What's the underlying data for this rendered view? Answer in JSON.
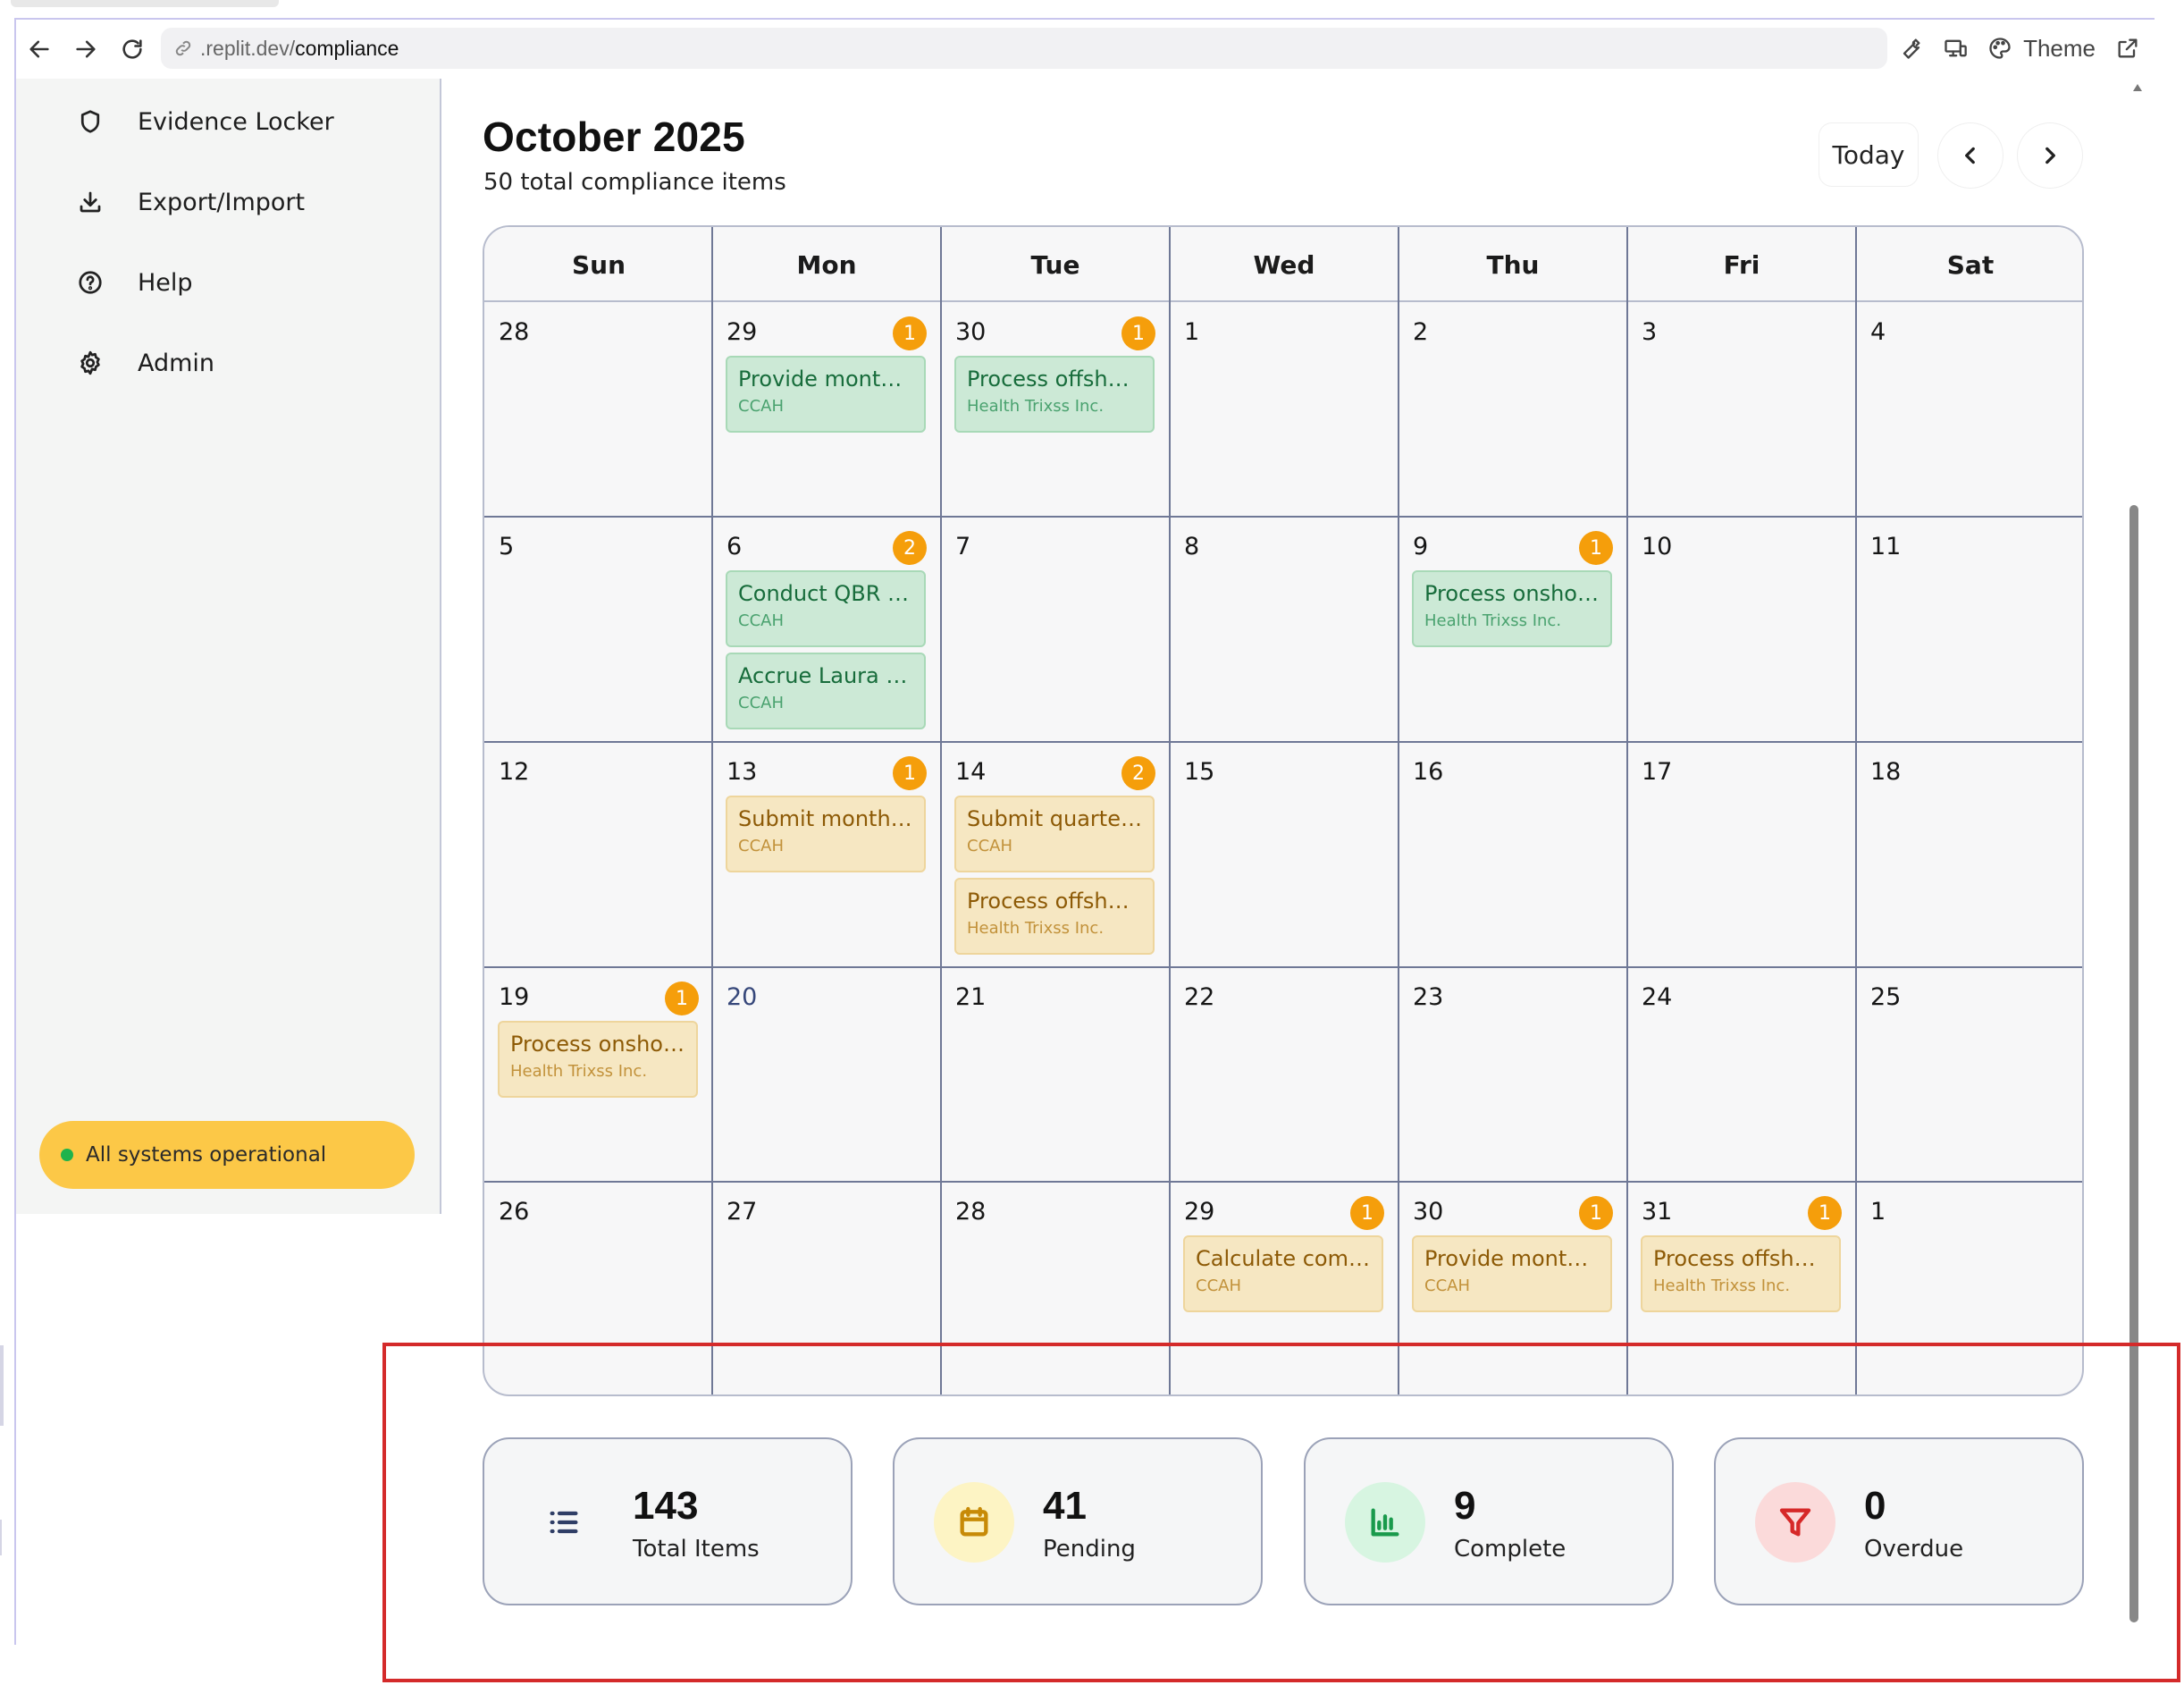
{
  "browser": {
    "url_host": ".replit.dev/",
    "url_path": "compliance",
    "theme_label": "Theme",
    "icons": [
      "back-arrow-icon",
      "forward-arrow-icon",
      "reload-icon",
      "link-icon",
      "wrench-icon",
      "devices-icon",
      "palette-icon",
      "open-external-icon"
    ]
  },
  "sidebar": {
    "items": [
      {
        "label": "Evidence Locker",
        "icon": "shield-icon"
      },
      {
        "label": "Export/Import",
        "icon": "download-icon"
      },
      {
        "label": "Help",
        "icon": "help-circle-icon"
      },
      {
        "label": "Admin",
        "icon": "gear-icon"
      }
    ],
    "status": "All systems operational"
  },
  "header": {
    "title": "October 2025",
    "subtitle": "50 total compliance items",
    "today_label": "Today",
    "prev_icon": "chevron-left-icon",
    "next_icon": "chevron-right-icon"
  },
  "calendar": {
    "weekdays": [
      "Sun",
      "Mon",
      "Tue",
      "Wed",
      "Thu",
      "Fri",
      "Sat"
    ],
    "weeks": [
      [
        "28",
        "29",
        "30",
        "1",
        "2",
        "3",
        "4"
      ],
      [
        "5",
        "6",
        "7",
        "8",
        "9",
        "10",
        "11"
      ],
      [
        "12",
        "13",
        "14",
        "15",
        "16",
        "17",
        "18"
      ],
      [
        "19",
        "20",
        "21",
        "22",
        "23",
        "24",
        "25"
      ],
      [
        "26",
        "27",
        "28",
        "29",
        "30",
        "31",
        "1"
      ]
    ],
    "today": "20",
    "day_counts": [
      {
        "date": "29",
        "count": "1"
      },
      {
        "date": "30",
        "count": "1"
      },
      {
        "date": "6",
        "count": "2"
      },
      {
        "date": "9",
        "count": "1"
      },
      {
        "date": "13",
        "count": "1"
      },
      {
        "date": "14",
        "count": "2"
      },
      {
        "date": "19",
        "count": "1"
      },
      {
        "date": "29",
        "count": "1"
      },
      {
        "date": "30",
        "count": "1"
      },
      {
        "date": "31",
        "count": "1"
      }
    ],
    "events": [
      {
        "date": "29",
        "title": "Provide monthly ...",
        "org": "CCAH",
        "status": "green"
      },
      {
        "date": "30",
        "title": "Process offshore...",
        "org": "Health Trixss Inc.",
        "status": "green"
      },
      {
        "date": "6",
        "title": "Conduct QBR for...",
        "org": "CCAH",
        "status": "green"
      },
      {
        "date": "6",
        "title": "Accrue Laura Gle...",
        "org": "CCAH",
        "status": "green"
      },
      {
        "date": "9",
        "title": "Process onshore...",
        "org": "Health Trixss Inc.",
        "status": "green"
      },
      {
        "date": "13",
        "title": "Submit monthly ...",
        "org": "CCAH",
        "status": "amber"
      },
      {
        "date": "14",
        "title": "Submit quarterly...",
        "org": "CCAH",
        "status": "amber"
      },
      {
        "date": "14",
        "title": "Process offshore...",
        "org": "Health Trixss Inc.",
        "status": "amber"
      },
      {
        "date": "19",
        "title": "Process onshore...",
        "org": "Health Trixss Inc.",
        "status": "amber"
      },
      {
        "date": "29",
        "title": "Calculate commi...",
        "org": "CCAH",
        "status": "amber"
      },
      {
        "date": "30",
        "title": "Provide monthly ...",
        "org": "CCAH",
        "status": "amber"
      },
      {
        "date": "31",
        "title": "Process offshore...",
        "org": "Health Trixss Inc.",
        "status": "amber"
      }
    ]
  },
  "stats": [
    {
      "value": "143",
      "label": "Total Items",
      "icon": "list-icon"
    },
    {
      "value": "41",
      "label": "Pending",
      "icon": "calendar-icon"
    },
    {
      "value": "9",
      "label": "Complete",
      "icon": "bar-chart-icon"
    },
    {
      "value": "0",
      "label": "Overdue",
      "icon": "filter-icon"
    }
  ],
  "colors": {
    "badge": "#f59e0b",
    "status_pill": "#fcc847",
    "status_dot": "#1fb34c",
    "event_green_bg": "#cce9d6",
    "event_amber_bg": "#f6e7c2",
    "highlight_box": "#d42a2a"
  }
}
